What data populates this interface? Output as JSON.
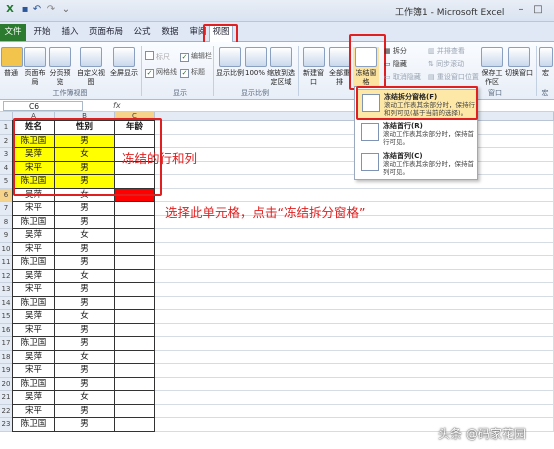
{
  "window": {
    "title": "工作簿1 - Microsoft Excel"
  },
  "tabs": [
    "文件",
    "开始",
    "插入",
    "页面布局",
    "公式",
    "数据",
    "审阅",
    "视图"
  ],
  "ribbon": {
    "buttons": {
      "normal": "普通",
      "page_layout": "页面布局",
      "page_break": "分页预览",
      "custom_views": "自定义视图",
      "full_screen": "全屏显示",
      "zoom": "显示比例",
      "zoom100": "100%",
      "zoom_sel": "缩放到选定区域",
      "new_window": "新建窗口",
      "arrange_all": "全部重排",
      "freeze": "冻结窗格",
      "save_ws": "保存工作区",
      "switch_window": "切换窗口",
      "macro": "宏"
    },
    "checks": [
      {
        "label": "标尺",
        "checked": false,
        "dim": true
      },
      {
        "label": "编辑栏",
        "checked": true,
        "dim": false
      },
      {
        "label": "网格线",
        "checked": true,
        "dim": false
      },
      {
        "label": "标题",
        "checked": true,
        "dim": false
      }
    ],
    "small": {
      "split": "拆分",
      "hide": "隐藏",
      "unhide": "取消隐藏",
      "side": "并排查看",
      "sync": "同步滚动",
      "reset": "重设窗口位置"
    },
    "groups": {
      "views": "工作簿视图",
      "show": "显示",
      "zoom": "显示比例",
      "window": "窗口",
      "macros": "宏"
    }
  },
  "formula_bar": {
    "name_box": "C6",
    "fx": "fx"
  },
  "columns": [
    "A",
    "B",
    "C"
  ],
  "table": {
    "headers": [
      "姓名",
      "性别",
      "年龄"
    ],
    "rows": [
      [
        "陈卫国",
        "男"
      ],
      [
        "吴萍",
        "女"
      ],
      [
        "宋平",
        "男"
      ],
      [
        "陈卫国",
        "男"
      ],
      [
        "吴萍",
        "女"
      ],
      [
        "宋平",
        "男"
      ],
      [
        "陈卫国",
        "男"
      ],
      [
        "吴萍",
        "女"
      ],
      [
        "宋平",
        "男"
      ],
      [
        "陈卫国",
        "男"
      ],
      [
        "吴萍",
        "女"
      ],
      [
        "宋平",
        "男"
      ],
      [
        "陈卫国",
        "男"
      ],
      [
        "吴萍",
        "女"
      ],
      [
        "宋平",
        "男"
      ],
      [
        "陈卫国",
        "男"
      ],
      [
        "吴萍",
        "女"
      ],
      [
        "宋平",
        "男"
      ],
      [
        "陈卫国",
        "男"
      ],
      [
        "吴萍",
        "女"
      ],
      [
        "宋平",
        "男"
      ],
      [
        "陈卫国",
        "男"
      ]
    ]
  },
  "freeze_menu": {
    "items": [
      {
        "title": "冻结拆分窗格(F)",
        "desc": "滚动工作表其余部分时，保持行和列可见(基于当前的选择)。"
      },
      {
        "title": "冻结首行(R)",
        "desc": "滚动工作表其余部分时，保持首行可见。"
      },
      {
        "title": "冻结首列(C)",
        "desc": "滚动工作表其余部分时，保持首列可见。"
      }
    ]
  },
  "annotations": {
    "frozen_label": "冻结的行和列",
    "instruction": "选择此单元格，点击“冻结拆分窗格”"
  },
  "watermark": "头条 @码家花园",
  "colors": {
    "accent_red": "#e02020",
    "highlight_yellow": "#ffff00",
    "selected_red": "#ff0000",
    "file_tab_green": "#2b7a2f"
  }
}
